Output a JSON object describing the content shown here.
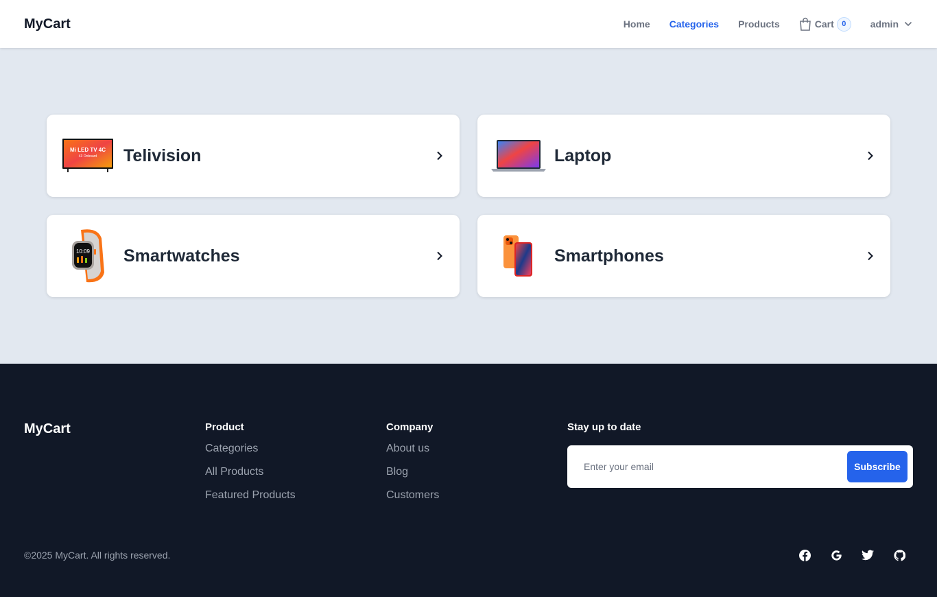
{
  "header": {
    "brand": "MyCart",
    "nav": [
      {
        "label": "Home"
      },
      {
        "label": "Categories",
        "active": true
      },
      {
        "label": "Products"
      }
    ],
    "cart": {
      "label": "Cart",
      "count": "0"
    },
    "user": {
      "label": "admin"
    }
  },
  "categories": [
    {
      "label": "Telivision",
      "icon": "tv-image"
    },
    {
      "label": "Laptop",
      "icon": "laptop-image"
    },
    {
      "label": "Smartwatches",
      "icon": "smartwatch-image"
    },
    {
      "label": "Smartphones",
      "icon": "smartphone-image"
    }
  ],
  "tv_screen_text": [
    "Mi LED TV 4C",
    "43 Onboard"
  ],
  "footer": {
    "brand": "MyCart",
    "product": {
      "heading": "Product",
      "links": [
        "Categories",
        "All Products",
        "Featured Products"
      ]
    },
    "company": {
      "heading": "Company",
      "links": [
        "About us",
        "Blog",
        "Customers"
      ]
    },
    "subscribe": {
      "heading": "Stay up to date",
      "placeholder": "Enter your email",
      "button": "Subscribe"
    },
    "copyright": "©2025 MyCart. All rights reserved.",
    "socials": [
      "facebook-icon",
      "google-icon",
      "twitter-icon",
      "github-icon"
    ]
  },
  "colors": {
    "accent": "#2563eb",
    "page_bg": "#e2e8f0",
    "footer_bg": "#111827"
  }
}
